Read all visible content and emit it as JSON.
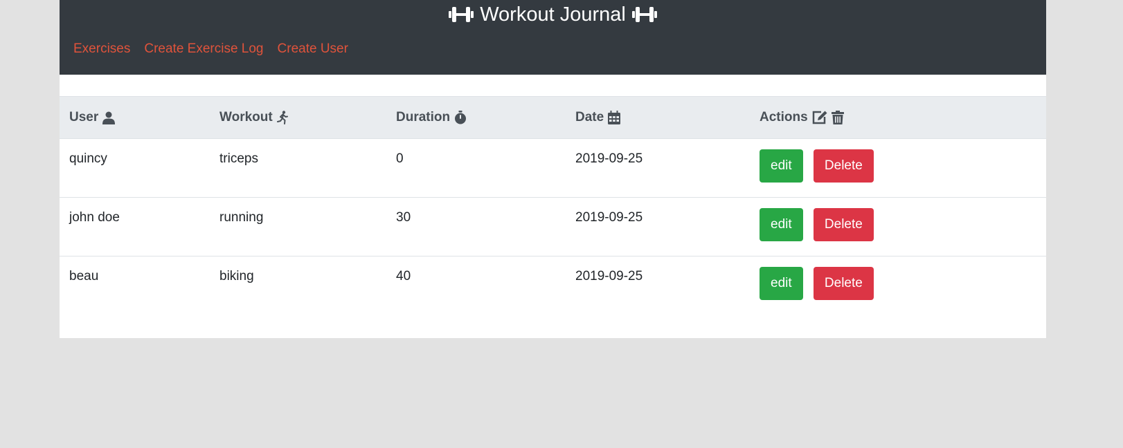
{
  "header": {
    "title": "Workout Journal",
    "brand_icon": "dumbbell-icon"
  },
  "nav": {
    "items": [
      {
        "label": "Exercises"
      },
      {
        "label": "Create Exercise Log"
      },
      {
        "label": "Create User"
      }
    ]
  },
  "table": {
    "columns": [
      {
        "label": "User",
        "icon": "user-icon"
      },
      {
        "label": "Workout",
        "icon": "running-icon"
      },
      {
        "label": "Duration",
        "icon": "stopwatch-icon"
      },
      {
        "label": "Date",
        "icon": "calendar-icon"
      },
      {
        "label": "Actions",
        "icons": [
          "edit-icon",
          "trash-icon"
        ]
      }
    ],
    "rows": [
      {
        "user": "quincy",
        "workout": "triceps",
        "duration": "0",
        "date": "2019-09-25",
        "edit_label": "edit",
        "delete_label": "Delete"
      },
      {
        "user": "john doe",
        "workout": "running",
        "duration": "30",
        "date": "2019-09-25",
        "edit_label": "edit",
        "delete_label": "Delete"
      },
      {
        "user": "beau",
        "workout": "biking",
        "duration": "40",
        "date": "2019-09-25",
        "edit_label": "edit",
        "delete_label": "Delete"
      }
    ]
  },
  "colors": {
    "navbar_bg": "#343a40",
    "nav_link": "#e0533b",
    "edit_button": "#28a745",
    "delete_button": "#dc3545",
    "page_bg": "#e2e2e2"
  }
}
